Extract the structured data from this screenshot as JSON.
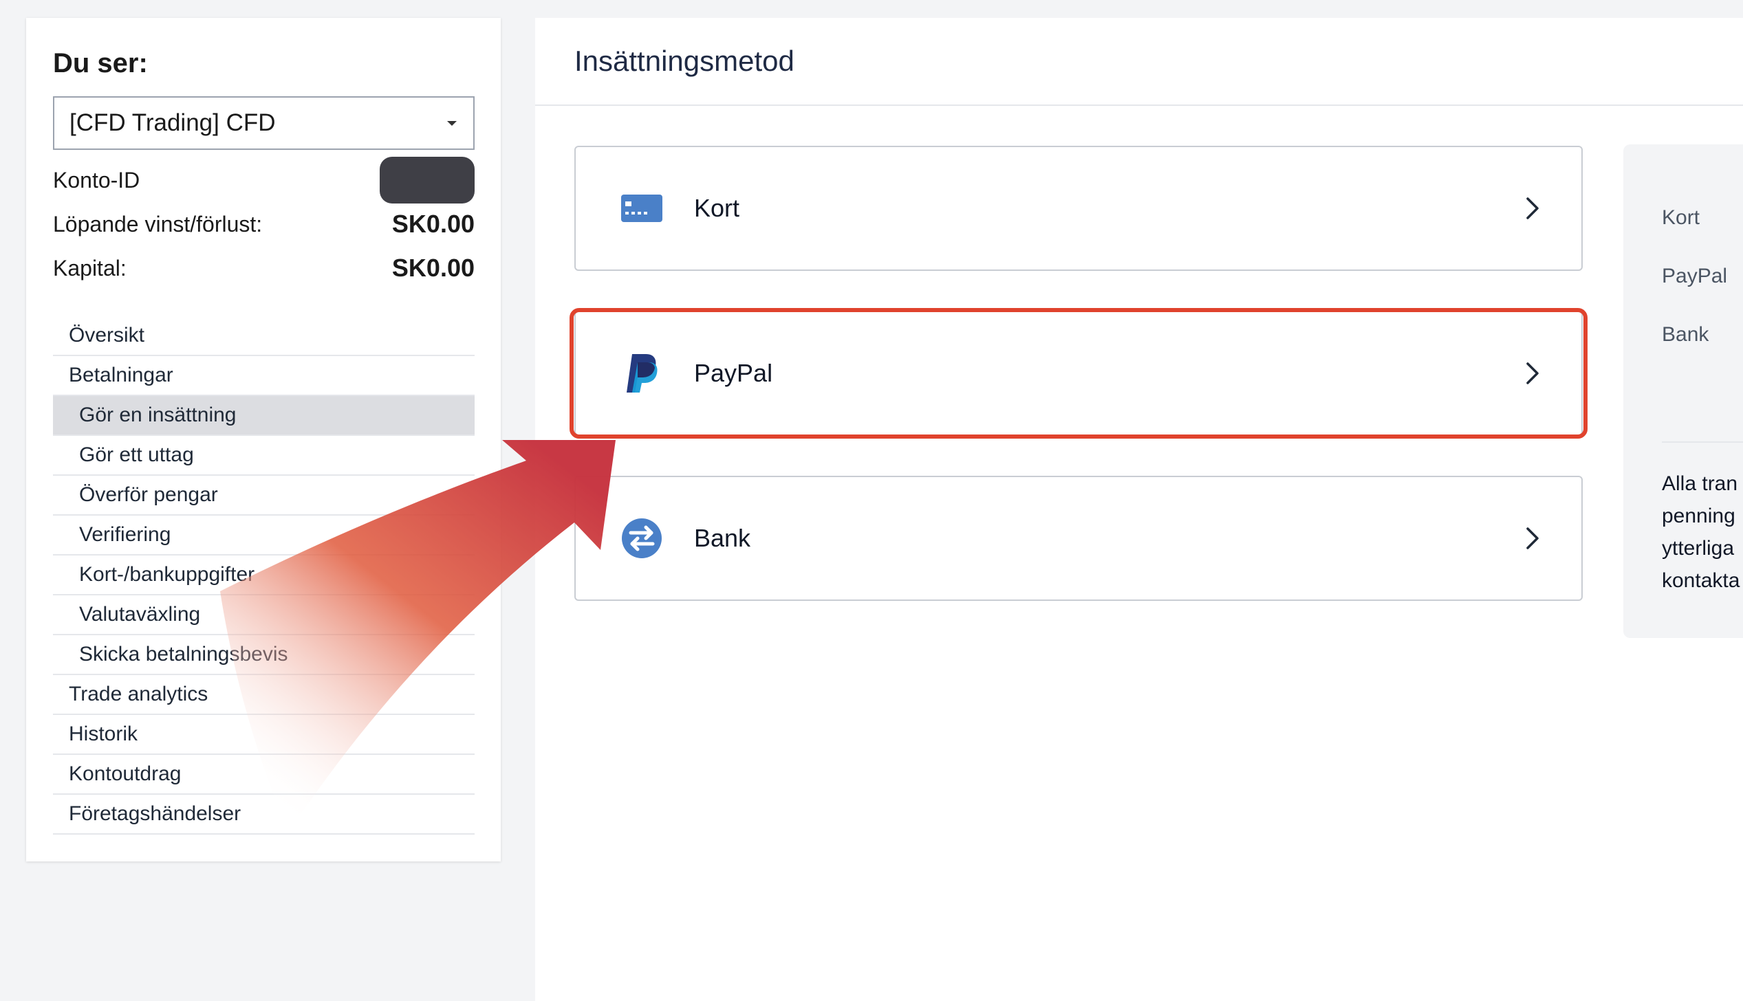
{
  "sidebar": {
    "title": "Du ser:",
    "account_select_value": "[CFD Trading] CFD",
    "account_id_label": "Konto-ID",
    "running_pl_label": "Löpande vinst/förlust:",
    "running_pl_value": "SK0.00",
    "equity_label": "Kapital:",
    "equity_value": "SK0.00",
    "nav": [
      {
        "label": "Översikt"
      },
      {
        "label": "Betalningar"
      },
      {
        "label": "Gör en insättning"
      },
      {
        "label": "Gör ett uttag"
      },
      {
        "label": "Överför pengar"
      },
      {
        "label": "Verifiering"
      },
      {
        "label": "Kort-/bankuppgifter"
      },
      {
        "label": "Valutaväxling"
      },
      {
        "label": "Skicka betalningsbevis"
      },
      {
        "label": "Trade analytics"
      },
      {
        "label": "Historik"
      },
      {
        "label": "Kontoutdrag"
      },
      {
        "label": "Företagshändelser"
      }
    ]
  },
  "main": {
    "title": "Insättningsmetod",
    "methods": [
      {
        "label": "Kort",
        "icon": "credit-card-icon"
      },
      {
        "label": "PayPal",
        "icon": "paypal-icon"
      },
      {
        "label": "Bank",
        "icon": "bank-transfer-icon"
      }
    ]
  },
  "info_panel": {
    "items": [
      "Kort",
      "PayPal",
      "Bank"
    ],
    "note_lines": [
      "Alla tran",
      "penning",
      "ytterliga",
      "kontakta"
    ]
  },
  "colors": {
    "highlight": "#e0432d",
    "active_nav": "#dcdde1",
    "card_icon": "#4a80c8",
    "paypal_dark": "#253b80",
    "paypal_light": "#179bd7",
    "bank_icon": "#4a80c8"
  }
}
